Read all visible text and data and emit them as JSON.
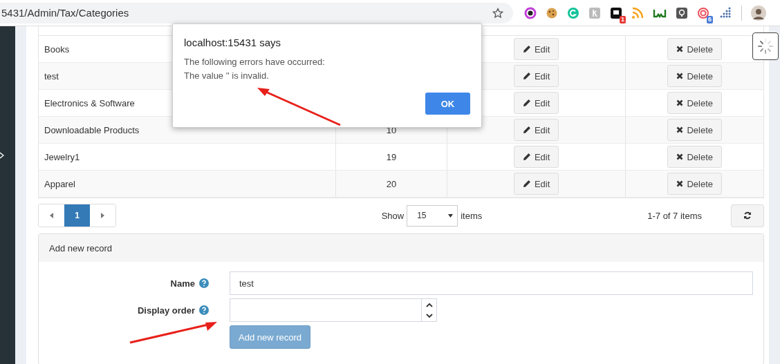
{
  "browser": {
    "url": "5431/Admin/Tax/Categories",
    "extension_badges": [
      "1",
      "6"
    ]
  },
  "table": {
    "rows": [
      {
        "name": "Books",
        "edit": "Edit",
        "delete": "Delete"
      },
      {
        "name": "test",
        "edit": "Edit",
        "delete": "Delete"
      },
      {
        "name": "Electronics & Software",
        "edit": "Edit",
        "delete": "Delete"
      },
      {
        "name": "Downloadable Products",
        "order": "10",
        "edit": "Edit",
        "delete": "Delete"
      },
      {
        "name": "Jewelry1",
        "order": "19",
        "edit": "Edit",
        "delete": "Delete"
      },
      {
        "name": "Apparel",
        "order": "20",
        "edit": "Edit",
        "delete": "Delete"
      }
    ]
  },
  "pager": {
    "pages": [
      {
        "label": "1",
        "selected": true
      }
    ],
    "show_label": "Show",
    "page_size": "15",
    "items_label": "items",
    "summary": "1-7 of 7 items"
  },
  "add_panel": {
    "title": "Add new record",
    "fields": [
      {
        "kind": "text",
        "label": "Name",
        "value": "test"
      },
      {
        "kind": "number",
        "label": "Display order"
      }
    ],
    "button": {
      "label": "Add new record",
      "disabled": true
    }
  },
  "dialog": {
    "title": "localhost:15431 says",
    "lines": [
      "The following errors have occurred:",
      "The value '' is invalid."
    ],
    "button": "OK"
  }
}
